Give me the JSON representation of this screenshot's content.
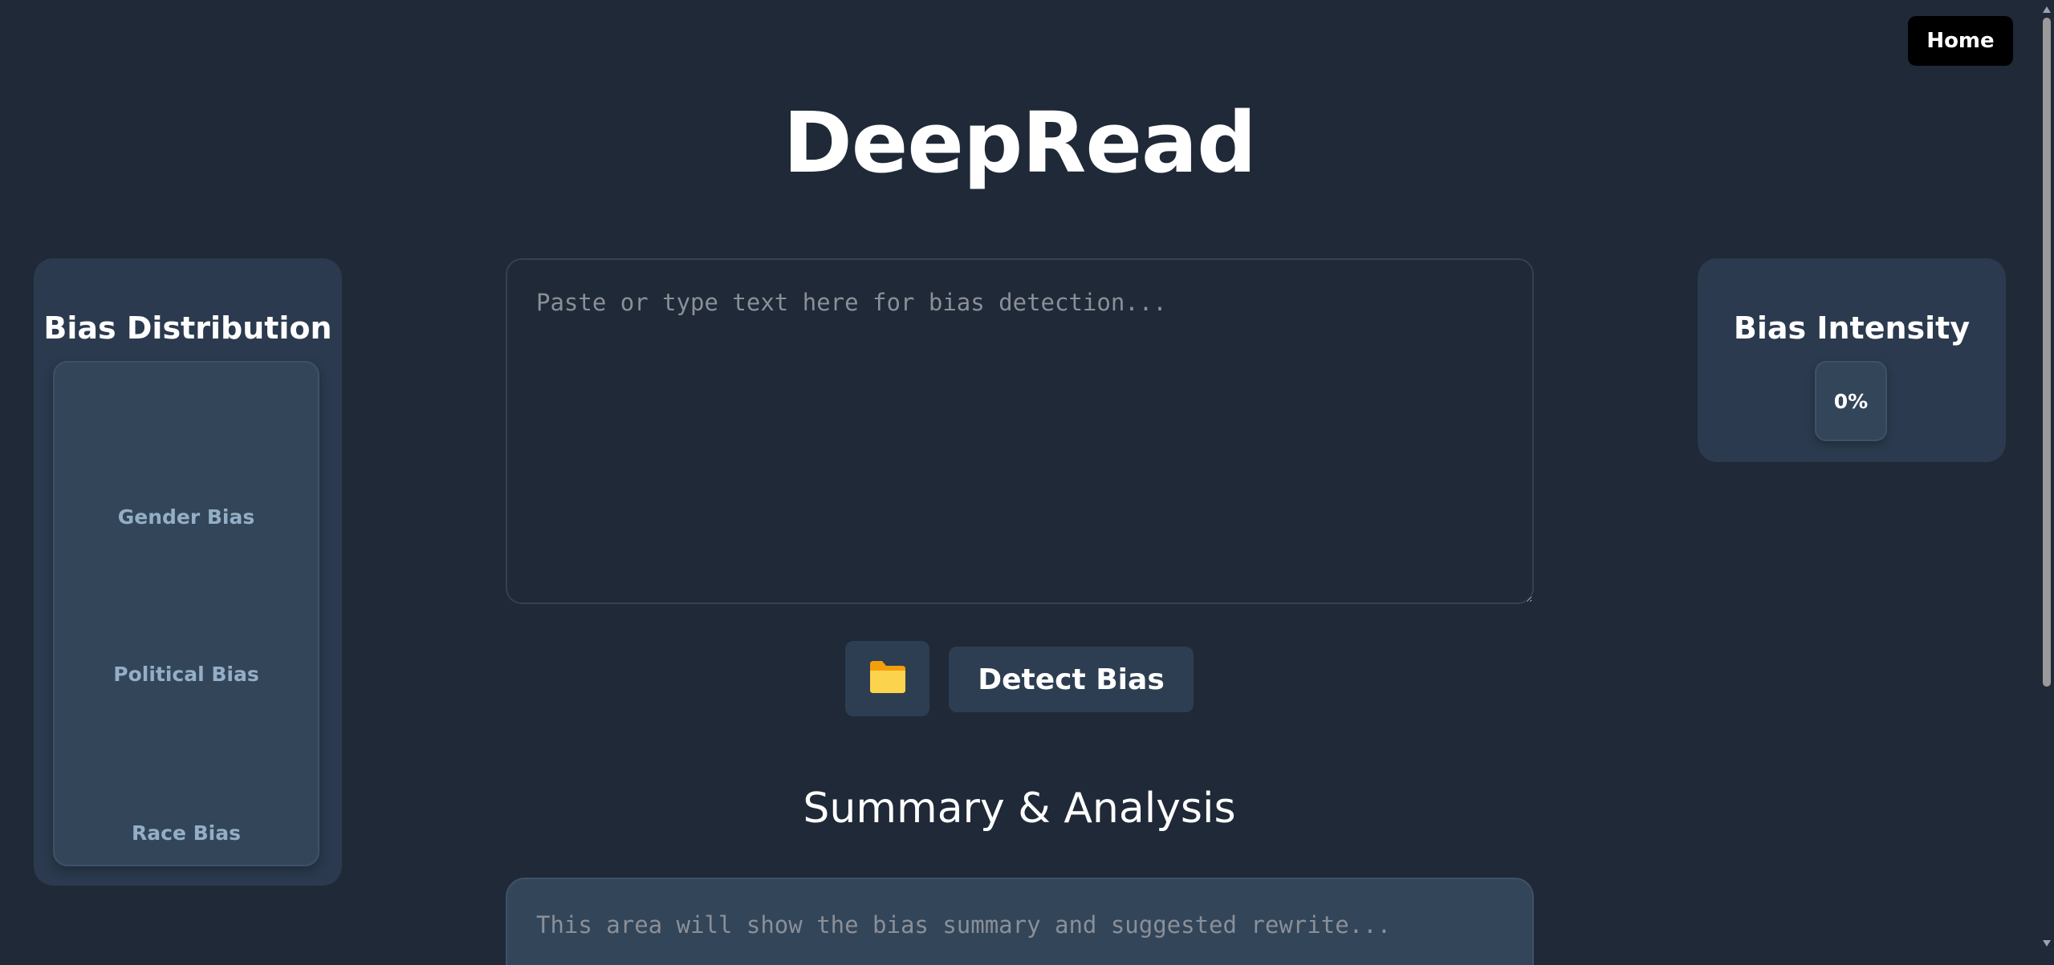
{
  "nav": {
    "home_label": "Home"
  },
  "header": {
    "title": "DeepRead"
  },
  "distribution": {
    "title": "Bias Distribution",
    "labels": [
      "Gender Bias",
      "Political Bias",
      "Race Bias"
    ]
  },
  "intensity": {
    "title": "Bias Intensity",
    "value": "0%"
  },
  "input": {
    "placeholder": "Paste or type text here for bias detection...",
    "value": ""
  },
  "actions": {
    "folder_icon": "folder-icon",
    "folder_color": "#fbbf24",
    "detect_label": "Detect Bias"
  },
  "summary": {
    "title": "Summary & Analysis",
    "placeholder": "This area will show the bias summary and suggested rewrite..."
  }
}
